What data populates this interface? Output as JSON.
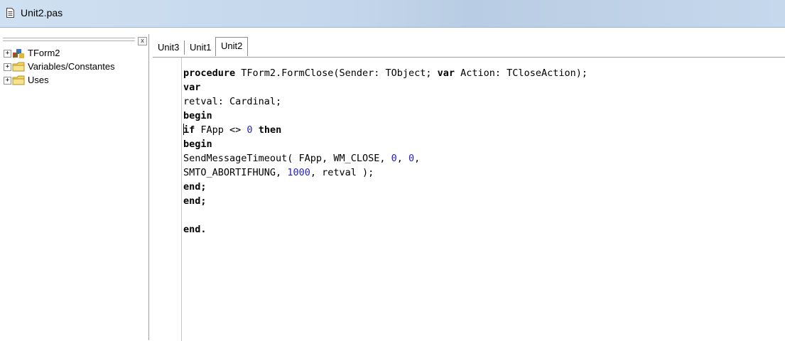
{
  "window": {
    "title": "Unit2.pas",
    "title_icon": "document-icon"
  },
  "explorer": {
    "close_label": "x",
    "items": [
      {
        "label": "TForm2",
        "icon": "form-icon",
        "expander": "+"
      },
      {
        "label": "Variables/Constantes",
        "icon": "folder-icon",
        "expander": "+"
      },
      {
        "label": "Uses",
        "icon": "folder-icon",
        "expander": "+"
      }
    ]
  },
  "tabs": [
    {
      "label": "Unit3",
      "active": false
    },
    {
      "label": "Unit1",
      "active": false
    },
    {
      "label": "Unit2",
      "active": true
    }
  ],
  "editor": {
    "lines": [
      [
        {
          "t": "procedure",
          "k": "kw"
        },
        {
          "t": " TForm2.FormClose(Sender: TObject; "
        },
        {
          "t": "var",
          "k": "kw"
        },
        {
          "t": " Action: TCloseAction);"
        }
      ],
      [
        {
          "t": "var",
          "k": "kw"
        }
      ],
      [
        {
          "t": "retval: Cardinal;"
        }
      ],
      [
        {
          "t": "begin",
          "k": "kw"
        }
      ],
      [
        {
          "t": "if",
          "k": "kw"
        },
        {
          "t": " FApp <> "
        },
        {
          "t": "0",
          "k": "num"
        },
        {
          "t": " "
        },
        {
          "t": "then",
          "k": "kw"
        }
      ],
      [
        {
          "t": "begin",
          "k": "kw"
        }
      ],
      [
        {
          "t": "SendMessageTimeout( FApp, WM_CLOSE, "
        },
        {
          "t": "0",
          "k": "num"
        },
        {
          "t": ", "
        },
        {
          "t": "0",
          "k": "num"
        },
        {
          "t": ","
        }
      ],
      [
        {
          "t": "SMTO_ABORTIFHUNG, "
        },
        {
          "t": "1000",
          "k": "num"
        },
        {
          "t": ", retval );"
        }
      ],
      [
        {
          "t": "end;",
          "k": "kw"
        }
      ],
      [
        {
          "t": "end;",
          "k": "kw"
        }
      ],
      [],
      [
        {
          "t": "end.",
          "k": "kw"
        }
      ]
    ],
    "caret_line": 4
  },
  "colors": {
    "keyword": "#000000",
    "number": "#1f1fd0",
    "titlebar": "#c3d6eb"
  }
}
